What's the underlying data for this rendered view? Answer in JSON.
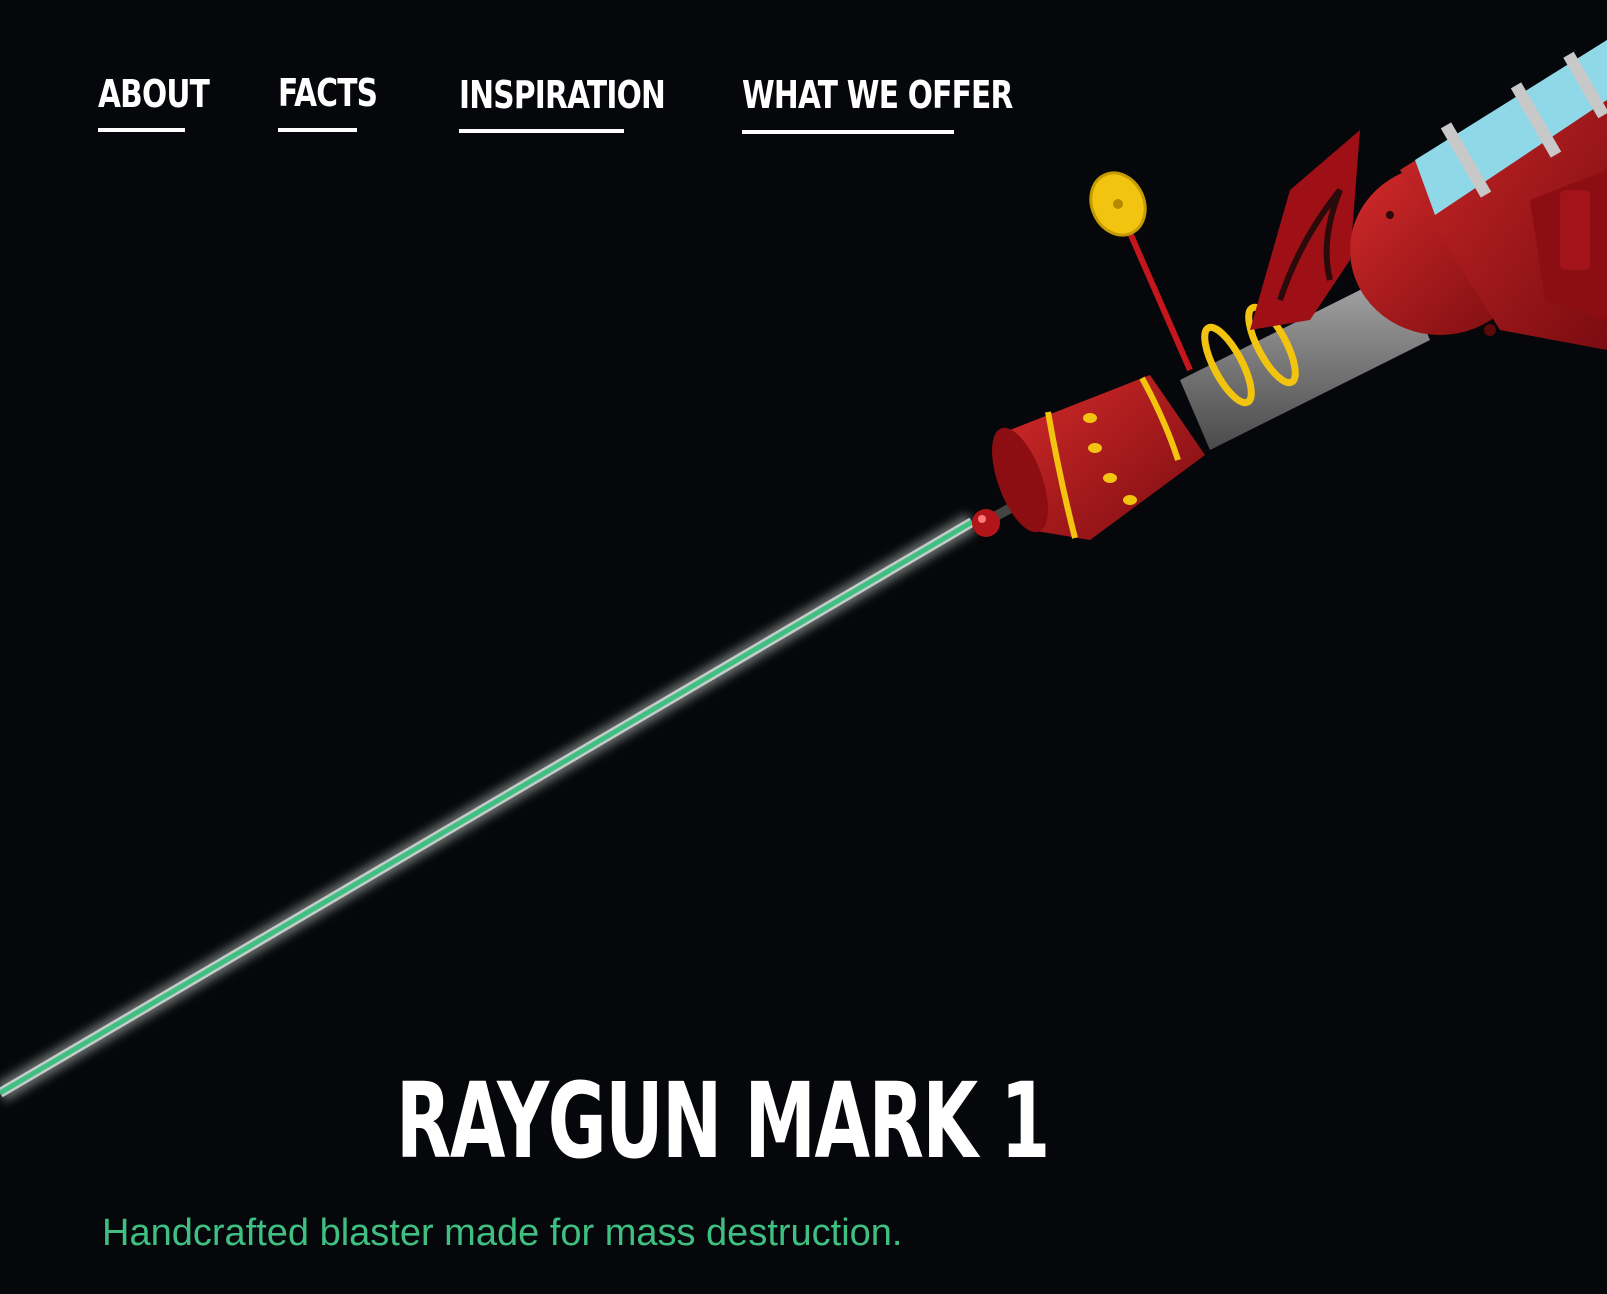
{
  "nav": {
    "items": [
      {
        "label": "ABOUT"
      },
      {
        "label": "FACTS"
      },
      {
        "label": "INSPIRATION"
      },
      {
        "label": "WHAT WE OFFER"
      }
    ]
  },
  "hero": {
    "title": "RAYGUN MARK 1",
    "subtitle": "Handcrafted blaster made for mass destruction."
  },
  "colors": {
    "background": "#05070a",
    "accent": "#3fbf82",
    "text": "#ffffff",
    "gun_body": "#b5161b",
    "gun_trim": "#f2c40f",
    "gun_barrel_light": "#8fd8e8"
  },
  "icons": {
    "hero_image": "raygun-illustration"
  }
}
